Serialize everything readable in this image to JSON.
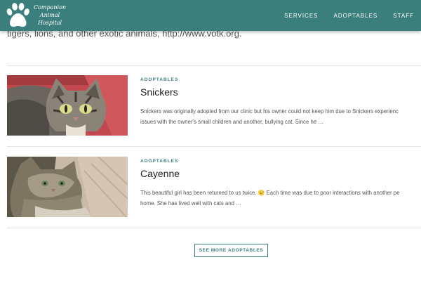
{
  "header": {
    "logo": {
      "line1": "Companion",
      "line2": "Animal",
      "line3": "Hospital"
    },
    "nav": [
      {
        "label": "SERVICES"
      },
      {
        "label": "ADOPTABLES"
      },
      {
        "label": "STAFF"
      }
    ],
    "brand_color": "#3b7f7c"
  },
  "intro": {
    "text": "tigers, lions, and other exotic animals, http://www.votk.org."
  },
  "posts": [
    {
      "category": "ADOPTABLES",
      "title": "Snickers",
      "image_icon": "tabby-cat-photo",
      "excerpt_line1": "Snickers was originally adopted from our clinic but  his owner could not keep him due to Snickers experienc",
      "excerpt_line2": "issues with the owner's small children and another, bullying cat. Since he …"
    },
    {
      "category": "ADOPTABLES",
      "title": "Cayenne",
      "image_icon": "longhair-cat-photo",
      "excerpt_line1": "This beautiful girl has been returned to us twice. 🙂 Each time was due to poor interactions with another pe",
      "excerpt_line2": "home. She has lived well with cats and …"
    }
  ],
  "see_more": {
    "label": "SEE MORE ADOPTABLES"
  }
}
